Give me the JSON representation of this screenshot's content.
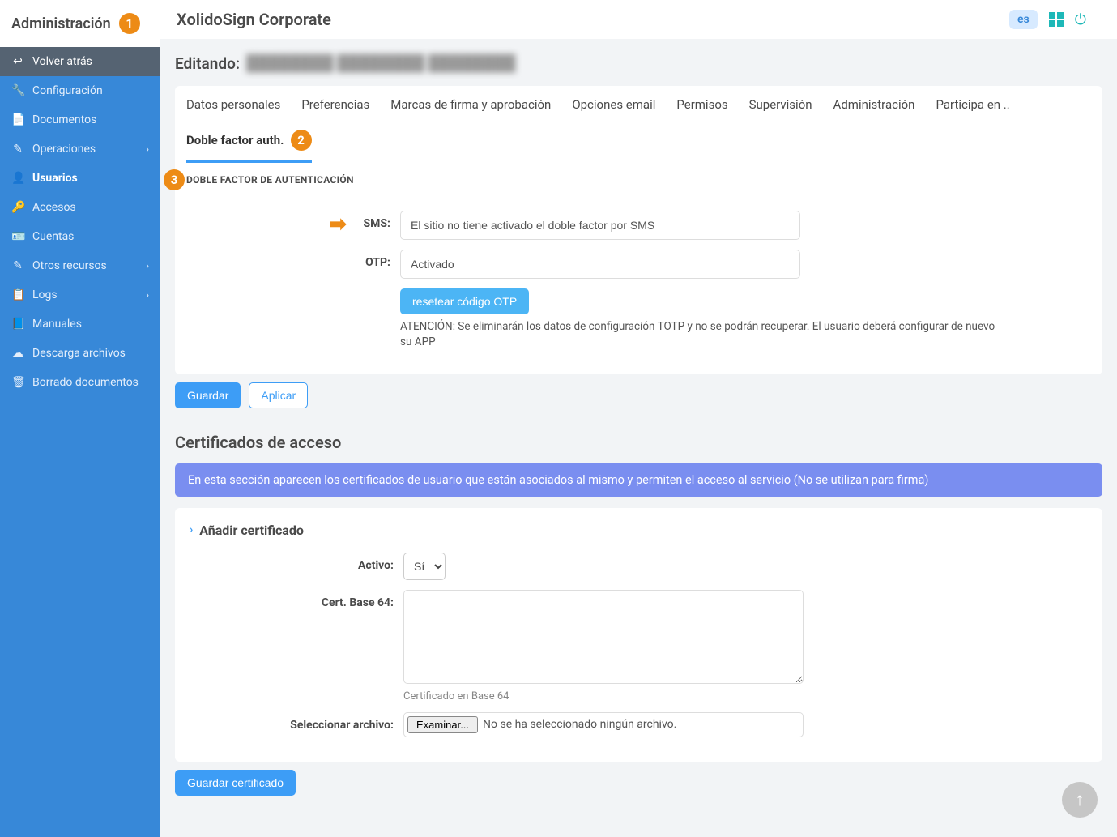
{
  "header": {
    "admin_title": "Administración",
    "brand": "XolidoSign Corporate",
    "lang": "es"
  },
  "sidebar": {
    "back": "Volver atrás",
    "items": [
      {
        "label": "Configuración"
      },
      {
        "label": "Documentos"
      },
      {
        "label": "Operaciones",
        "expandable": true
      },
      {
        "label": "Usuarios",
        "active": true
      },
      {
        "label": "Accesos"
      },
      {
        "label": "Cuentas"
      },
      {
        "label": "Otros recursos",
        "expandable": true
      },
      {
        "label": "Logs",
        "expandable": true
      },
      {
        "label": "Manuales"
      },
      {
        "label": "Descarga archivos"
      },
      {
        "label": "Borrado documentos"
      }
    ]
  },
  "editing": {
    "prefix": "Editando:",
    "value": "████████ ████████ ████████"
  },
  "tabs": [
    "Datos personales",
    "Preferencias",
    "Marcas de firma y aprobación",
    "Opciones email",
    "Permisos",
    "Supervisión",
    "Administración",
    "Participa en ..",
    "Doble factor auth."
  ],
  "active_tab": "Doble factor auth.",
  "panel": {
    "heading": "DOBLE FACTOR DE AUTENTICACIÓN",
    "sms_label": "SMS:",
    "sms_value": "El sitio no tiene activado el doble factor por SMS",
    "otp_label": "OTP:",
    "otp_value": "Activado",
    "reset_btn": "resetear código OTP",
    "warning": "ATENCIÓN: Se eliminarán los datos de configuración TOTP y no se podrán recuperar. El usuario deberá configurar de nuevo su APP",
    "save_btn": "Guardar",
    "apply_btn": "Aplicar"
  },
  "certs": {
    "title": "Certificados de acceso",
    "banner": "En esta sección aparecen los certificados de usuario que están asociados al mismo y permiten el acceso al servicio (No se utilizan para firma)",
    "add_heading": "Añadir certificado",
    "active_label": "Activo:",
    "active_value": "Sí",
    "b64_label": "Cert. Base 64:",
    "b64_help": "Certificado en Base 64",
    "file_label": "Seleccionar archivo:",
    "file_btn": "Examinar...",
    "file_none": "No se ha seleccionado ningún archivo.",
    "save_cert_btn": "Guardar certificado"
  },
  "annotations": {
    "b1": "1",
    "b2": "2",
    "b3": "3"
  }
}
